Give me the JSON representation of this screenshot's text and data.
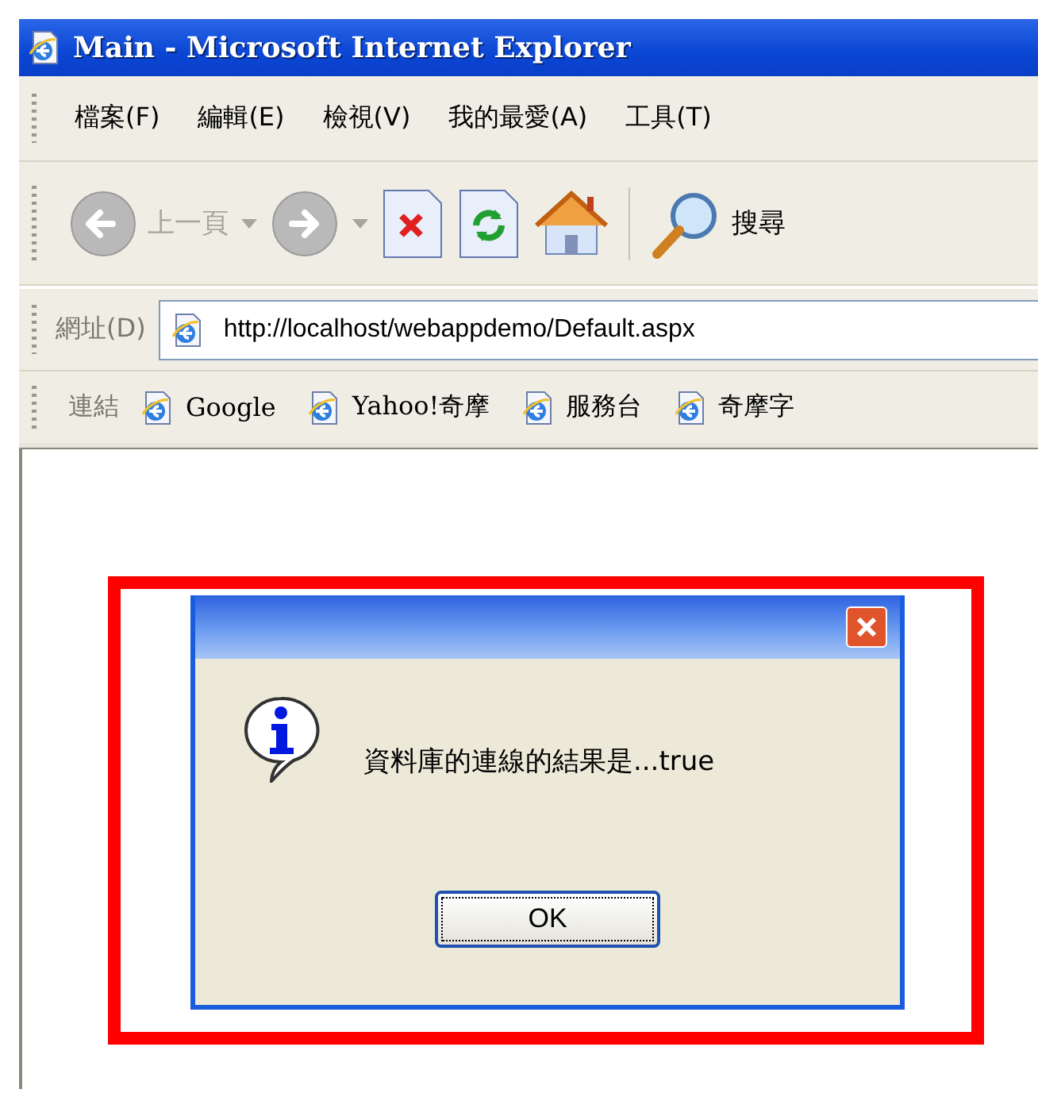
{
  "window": {
    "title": "Main - Microsoft Internet Explorer"
  },
  "menu": [
    "檔案(F)",
    "編輯(E)",
    "檢視(V)",
    "我的最愛(A)",
    "工具(T)"
  ],
  "toolbar": {
    "back": {
      "label": "上一頁",
      "disabled": true
    },
    "forward": {
      "disabled": true
    },
    "search": "搜尋"
  },
  "address": {
    "label": "網址(D)",
    "value": "http://localhost/webappdemo/Default.aspx"
  },
  "links": {
    "label": "連結",
    "items": [
      "Google",
      "Yahoo!奇摩",
      "服務台",
      "奇摩字"
    ]
  },
  "dialog": {
    "message": "資料庫的連線的結果是...true",
    "button": "OK"
  }
}
